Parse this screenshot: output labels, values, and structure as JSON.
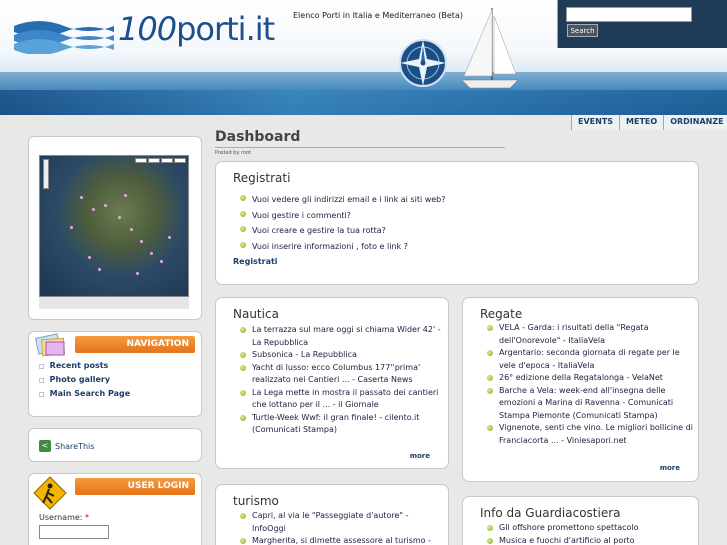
{
  "header": {
    "logo_number": "100",
    "logo_text": "porti.it",
    "tagline": "Elenco Porti in Italia e Mediterraneo (Beta)",
    "search_button": "Search",
    "search_value": ""
  },
  "topnav": [
    "EVENTS",
    "METEO",
    "ORDINANZE"
  ],
  "dashboard": {
    "title": "Dashboard",
    "posted_by": "Posted by root"
  },
  "navigation": {
    "title": "NAVIGATION",
    "items": [
      "Recent posts",
      "Photo gallery",
      "Main Search Page"
    ]
  },
  "share": {
    "label": "ShareThis"
  },
  "login": {
    "title": "USER LOGIN",
    "username_label": "Username:",
    "required_mark": "*"
  },
  "registrati": {
    "title": "Registrati",
    "items": [
      "Vuoi vedere gli indirizzi email e i link ai siti web?",
      "Vuoi gestire i commenti?",
      "Vuoi creare e gestire la tua rotta?",
      "Vuoi inserire informazioni , foto e link ?"
    ],
    "link": "Registrati"
  },
  "nautica": {
    "title": "Nautica",
    "items": [
      "La terrazza sul mare oggi si chiama Wider 42' - La Repubblica",
      "Subsonica - La Repubblica",
      "Yacht di lusso: ecco Columbus 177''prima' realizzato nei Cantieri ... - Caserta News",
      "La Lega mette in mostra il passato dei cantieri che lottano per il ... - il Giornale",
      "Turtle-Week Wwf: il gran finale! - cilento.it (Comunicati Stampa)"
    ],
    "more": "more"
  },
  "regate": {
    "title": "Regate",
    "items": [
      "VELA - Garda: i risultati della \"Regata dell'Onorevole\" - ItaliaVela",
      "Argentario: seconda giornata di regate per le vele d'epoca - ItaliaVela",
      "26° edizione della Regatalonga - VelaNet",
      "Barche a Vela: week-end all'insegna delle emozioni a Marina di Ravenna - Comunicati Stampa Piemonte (Comunicati Stampa)",
      "Vignenote, senti che vino. Le migliori bollicine di Franciacorta ... - Viniesapori.net"
    ],
    "more": "more"
  },
  "turismo": {
    "title": "turismo",
    "items": [
      "Capri, al via le \"Passeggiate d'autore\" - InfoOggi",
      "Margherita, si dimette assessore al turismo - Daunia News"
    ]
  },
  "guardia": {
    "title": "Info da Guardiacostiera",
    "items": [
      "Gli offshore promettono spettacolo",
      "Musica e fuochi d'artificio al porto"
    ]
  }
}
